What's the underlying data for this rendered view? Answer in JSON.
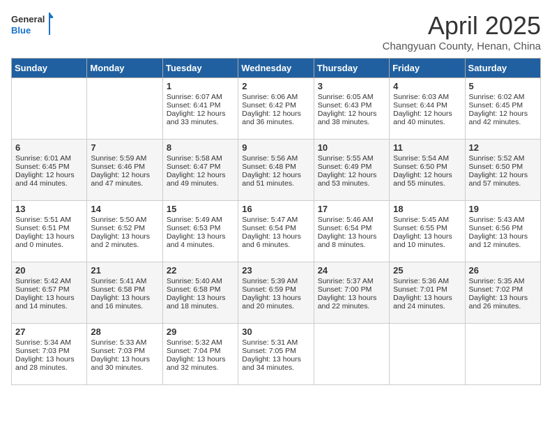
{
  "header": {
    "logo_general": "General",
    "logo_blue": "Blue",
    "month": "April 2025",
    "location": "Changyuan County, Henan, China"
  },
  "weekdays": [
    "Sunday",
    "Monday",
    "Tuesday",
    "Wednesday",
    "Thursday",
    "Friday",
    "Saturday"
  ],
  "weeks": [
    [
      {
        "day": "",
        "info": ""
      },
      {
        "day": "",
        "info": ""
      },
      {
        "day": "1",
        "info": "Sunrise: 6:07 AM\nSunset: 6:41 PM\nDaylight: 12 hours and 33 minutes."
      },
      {
        "day": "2",
        "info": "Sunrise: 6:06 AM\nSunset: 6:42 PM\nDaylight: 12 hours and 36 minutes."
      },
      {
        "day": "3",
        "info": "Sunrise: 6:05 AM\nSunset: 6:43 PM\nDaylight: 12 hours and 38 minutes."
      },
      {
        "day": "4",
        "info": "Sunrise: 6:03 AM\nSunset: 6:44 PM\nDaylight: 12 hours and 40 minutes."
      },
      {
        "day": "5",
        "info": "Sunrise: 6:02 AM\nSunset: 6:45 PM\nDaylight: 12 hours and 42 minutes."
      }
    ],
    [
      {
        "day": "6",
        "info": "Sunrise: 6:01 AM\nSunset: 6:45 PM\nDaylight: 12 hours and 44 minutes."
      },
      {
        "day": "7",
        "info": "Sunrise: 5:59 AM\nSunset: 6:46 PM\nDaylight: 12 hours and 47 minutes."
      },
      {
        "day": "8",
        "info": "Sunrise: 5:58 AM\nSunset: 6:47 PM\nDaylight: 12 hours and 49 minutes."
      },
      {
        "day": "9",
        "info": "Sunrise: 5:56 AM\nSunset: 6:48 PM\nDaylight: 12 hours and 51 minutes."
      },
      {
        "day": "10",
        "info": "Sunrise: 5:55 AM\nSunset: 6:49 PM\nDaylight: 12 hours and 53 minutes."
      },
      {
        "day": "11",
        "info": "Sunrise: 5:54 AM\nSunset: 6:50 PM\nDaylight: 12 hours and 55 minutes."
      },
      {
        "day": "12",
        "info": "Sunrise: 5:52 AM\nSunset: 6:50 PM\nDaylight: 12 hours and 57 minutes."
      }
    ],
    [
      {
        "day": "13",
        "info": "Sunrise: 5:51 AM\nSunset: 6:51 PM\nDaylight: 13 hours and 0 minutes."
      },
      {
        "day": "14",
        "info": "Sunrise: 5:50 AM\nSunset: 6:52 PM\nDaylight: 13 hours and 2 minutes."
      },
      {
        "day": "15",
        "info": "Sunrise: 5:49 AM\nSunset: 6:53 PM\nDaylight: 13 hours and 4 minutes."
      },
      {
        "day": "16",
        "info": "Sunrise: 5:47 AM\nSunset: 6:54 PM\nDaylight: 13 hours and 6 minutes."
      },
      {
        "day": "17",
        "info": "Sunrise: 5:46 AM\nSunset: 6:54 PM\nDaylight: 13 hours and 8 minutes."
      },
      {
        "day": "18",
        "info": "Sunrise: 5:45 AM\nSunset: 6:55 PM\nDaylight: 13 hours and 10 minutes."
      },
      {
        "day": "19",
        "info": "Sunrise: 5:43 AM\nSunset: 6:56 PM\nDaylight: 13 hours and 12 minutes."
      }
    ],
    [
      {
        "day": "20",
        "info": "Sunrise: 5:42 AM\nSunset: 6:57 PM\nDaylight: 13 hours and 14 minutes."
      },
      {
        "day": "21",
        "info": "Sunrise: 5:41 AM\nSunset: 6:58 PM\nDaylight: 13 hours and 16 minutes."
      },
      {
        "day": "22",
        "info": "Sunrise: 5:40 AM\nSunset: 6:58 PM\nDaylight: 13 hours and 18 minutes."
      },
      {
        "day": "23",
        "info": "Sunrise: 5:39 AM\nSunset: 6:59 PM\nDaylight: 13 hours and 20 minutes."
      },
      {
        "day": "24",
        "info": "Sunrise: 5:37 AM\nSunset: 7:00 PM\nDaylight: 13 hours and 22 minutes."
      },
      {
        "day": "25",
        "info": "Sunrise: 5:36 AM\nSunset: 7:01 PM\nDaylight: 13 hours and 24 minutes."
      },
      {
        "day": "26",
        "info": "Sunrise: 5:35 AM\nSunset: 7:02 PM\nDaylight: 13 hours and 26 minutes."
      }
    ],
    [
      {
        "day": "27",
        "info": "Sunrise: 5:34 AM\nSunset: 7:03 PM\nDaylight: 13 hours and 28 minutes."
      },
      {
        "day": "28",
        "info": "Sunrise: 5:33 AM\nSunset: 7:03 PM\nDaylight: 13 hours and 30 minutes."
      },
      {
        "day": "29",
        "info": "Sunrise: 5:32 AM\nSunset: 7:04 PM\nDaylight: 13 hours and 32 minutes."
      },
      {
        "day": "30",
        "info": "Sunrise: 5:31 AM\nSunset: 7:05 PM\nDaylight: 13 hours and 34 minutes."
      },
      {
        "day": "",
        "info": ""
      },
      {
        "day": "",
        "info": ""
      },
      {
        "day": "",
        "info": ""
      }
    ]
  ]
}
